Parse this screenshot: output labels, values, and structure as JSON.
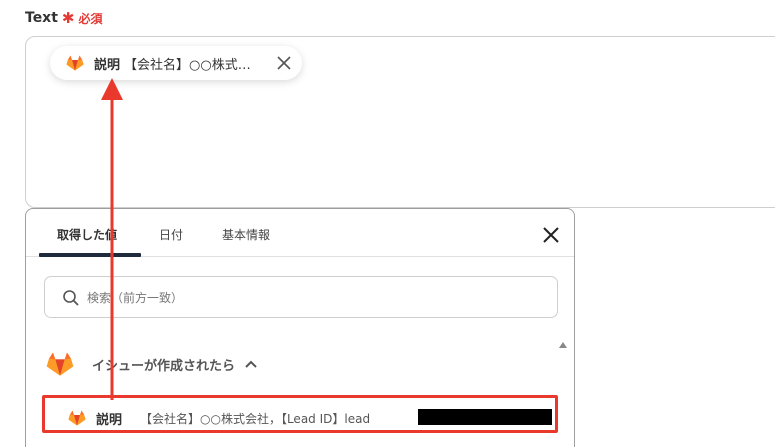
{
  "field": {
    "label": "Text",
    "required_mark": "✱",
    "required_text": "必須"
  },
  "chip": {
    "key": "説明",
    "value": "【会社名】○○株式…",
    "icon": "gitlab-icon",
    "close_icon": "close-icon"
  },
  "panel": {
    "tabs": [
      {
        "label": "取得した値",
        "active": true
      },
      {
        "label": "日付",
        "active": false
      },
      {
        "label": "基本情報",
        "active": false
      }
    ],
    "close_icon": "close-icon",
    "search": {
      "placeholder": "検索（前方一致）",
      "value": "",
      "icon": "search-icon"
    },
    "group": {
      "title": "イシューが作成されたら",
      "icon": "gitlab-icon",
      "expanded": true
    },
    "items": [
      {
        "key": "説明",
        "value": "【会社名】○○株式会社，【Lead ID】lead",
        "icon": "gitlab-icon",
        "redacted": true
      }
    ]
  },
  "colors": {
    "accent": "#1f2b3c",
    "required": "#e53935",
    "annotation": "#e8392c",
    "gitlab_orange": "#e24329",
    "gitlab_light": "#fc6d26",
    "gitlab_yellow": "#fca326"
  }
}
